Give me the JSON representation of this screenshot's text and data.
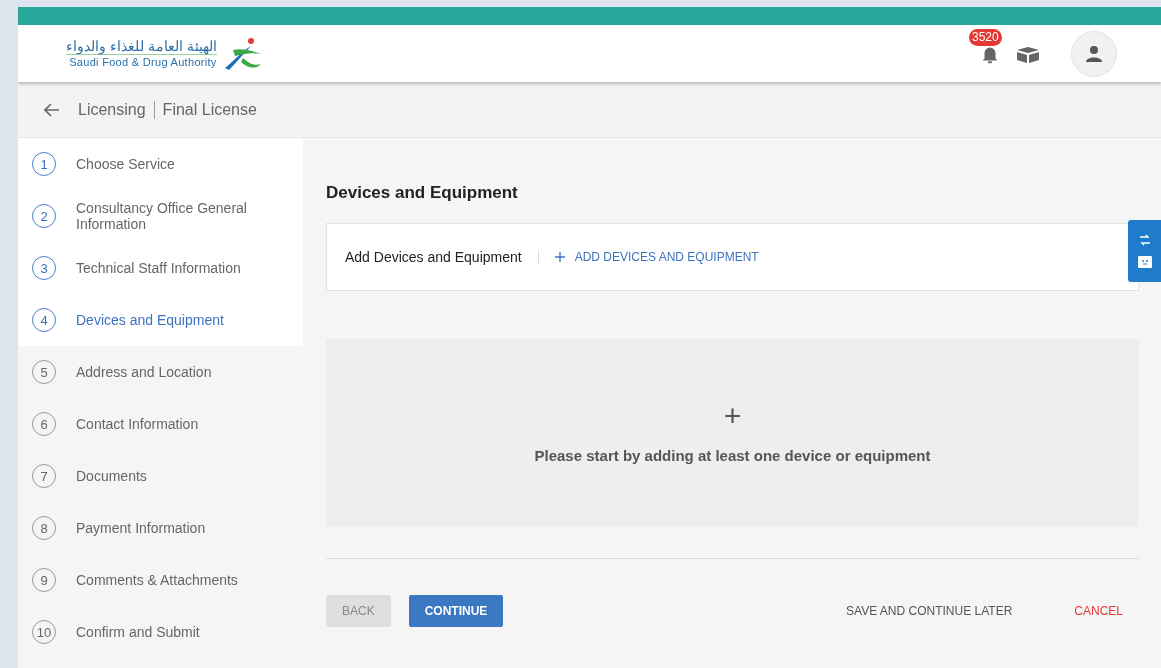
{
  "header": {
    "logo_arabic": "الهيئة العامة للغذاء والدواء",
    "logo_english": "Saudi Food & Drug Authority",
    "notification_count": "3520"
  },
  "breadcrumb": {
    "section": "Licensing",
    "page": "Final License"
  },
  "steps": [
    {
      "number": "1",
      "label": "Choose Service",
      "reached": true,
      "selected": false
    },
    {
      "number": "2",
      "label": "Consultancy Office General Information",
      "reached": true,
      "selected": false
    },
    {
      "number": "3",
      "label": "Technical Staff Information",
      "reached": true,
      "selected": false
    },
    {
      "number": "4",
      "label": "Devices and Equipment",
      "reached": true,
      "selected": true
    },
    {
      "number": "5",
      "label": "Address and Location",
      "reached": false,
      "selected": false
    },
    {
      "number": "6",
      "label": "Contact Information",
      "reached": false,
      "selected": false
    },
    {
      "number": "7",
      "label": "Documents",
      "reached": false,
      "selected": false
    },
    {
      "number": "8",
      "label": "Payment Information",
      "reached": false,
      "selected": false
    },
    {
      "number": "9",
      "label": "Comments & Attachments",
      "reached": false,
      "selected": false
    },
    {
      "number": "10",
      "label": "Confirm and Submit",
      "reached": false,
      "selected": false
    }
  ],
  "main": {
    "title": "Devices and Equipment",
    "add_label": "Add Devices and Equipment",
    "add_link": "ADD DEVICES AND EQUIPMENT",
    "empty_icon": "+",
    "empty_message": "Please start by adding at least one device or equipment"
  },
  "buttons": {
    "back": "BACK",
    "continue": "CONTINUE",
    "save_later": "SAVE AND CONTINUE LATER",
    "cancel": "CANCEL"
  }
}
